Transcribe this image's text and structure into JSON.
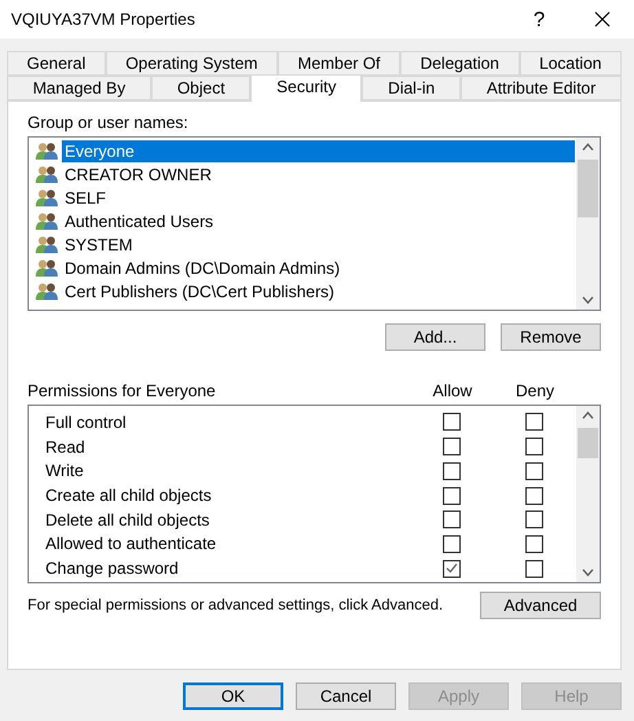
{
  "window": {
    "title": "VQIUYA37VM Properties",
    "help_glyph": "?"
  },
  "tab_rows": [
    [
      {
        "label": "General",
        "selected": false
      },
      {
        "label": "Operating System",
        "selected": false
      },
      {
        "label": "Member Of",
        "selected": false
      },
      {
        "label": "Delegation",
        "selected": false
      },
      {
        "label": "Location",
        "selected": false
      }
    ],
    [
      {
        "label": "Managed By",
        "selected": false
      },
      {
        "label": "Object",
        "selected": false
      },
      {
        "label": "Security",
        "selected": true
      },
      {
        "label": "Dial-in",
        "selected": false
      },
      {
        "label": "Attribute Editor",
        "selected": false
      }
    ]
  ],
  "groups": {
    "label": "Group or user names:",
    "items": [
      {
        "name": "Everyone",
        "selected": true
      },
      {
        "name": "CREATOR OWNER",
        "selected": false
      },
      {
        "name": "SELF",
        "selected": false
      },
      {
        "name": "Authenticated Users",
        "selected": false
      },
      {
        "name": "SYSTEM",
        "selected": false
      },
      {
        "name": "Domain Admins (DC\\Domain Admins)",
        "selected": false
      },
      {
        "name": "Cert Publishers (DC\\Cert Publishers)",
        "selected": false
      }
    ],
    "buttons": [
      {
        "label": "Add...",
        "disabled": false
      },
      {
        "label": "Remove",
        "disabled": false
      }
    ]
  },
  "permissions": {
    "label": "Permissions for Everyone",
    "allow_header": "Allow",
    "deny_header": "Deny",
    "rows": [
      {
        "name": "Full control",
        "allow": false,
        "deny": false
      },
      {
        "name": "Read",
        "allow": false,
        "deny": false
      },
      {
        "name": "Write",
        "allow": false,
        "deny": false
      },
      {
        "name": "Create all child objects",
        "allow": false,
        "deny": false
      },
      {
        "name": "Delete all child objects",
        "allow": false,
        "deny": false
      },
      {
        "name": "Allowed to authenticate",
        "allow": false,
        "deny": false
      },
      {
        "name": "Change password",
        "allow": true,
        "deny": false
      }
    ]
  },
  "advanced": {
    "text": "For special permissions or advanced settings, click Advanced.",
    "button": "Advanced"
  },
  "footer_buttons": [
    {
      "label": "OK",
      "default": true,
      "disabled": false
    },
    {
      "label": "Cancel",
      "default": false,
      "disabled": false
    },
    {
      "label": "Apply",
      "default": false,
      "disabled": true
    },
    {
      "label": "Help",
      "default": false,
      "disabled": true
    }
  ]
}
